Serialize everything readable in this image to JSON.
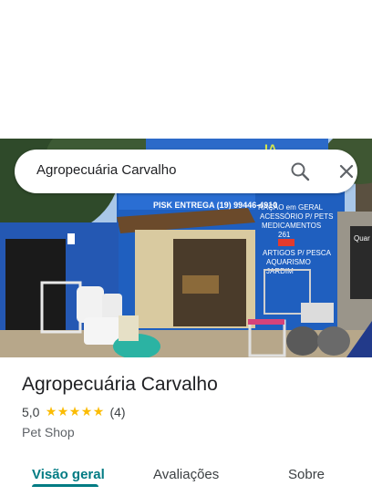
{
  "search": {
    "query": "Agropecuária Carvalho",
    "search_icon": "search-icon",
    "close_icon": "close-icon"
  },
  "photo": {
    "sign_texts": [
      "PISK ENTREGA (19) 99446-4910",
      "RAÇÃO em GERAL",
      "ACESSÓRIO P/ PETS",
      "MEDICAMENTOS",
      "261",
      "ARTIGOS P/ PESCA",
      "AQUARISMO",
      "JARDIM"
    ]
  },
  "place": {
    "title": "Agropecuária Carvalho",
    "rating": "5,0",
    "stars": 5,
    "reviews": "(4)",
    "category": "Pet Shop"
  },
  "tabs": [
    {
      "label": "Visão geral",
      "active": true
    },
    {
      "label": "Avaliações",
      "active": false
    },
    {
      "label": "Sobre",
      "active": false
    }
  ],
  "colors": {
    "accent": "#007b83",
    "star": "#fbbc04",
    "storefront_blue": "#1f5fbf"
  }
}
